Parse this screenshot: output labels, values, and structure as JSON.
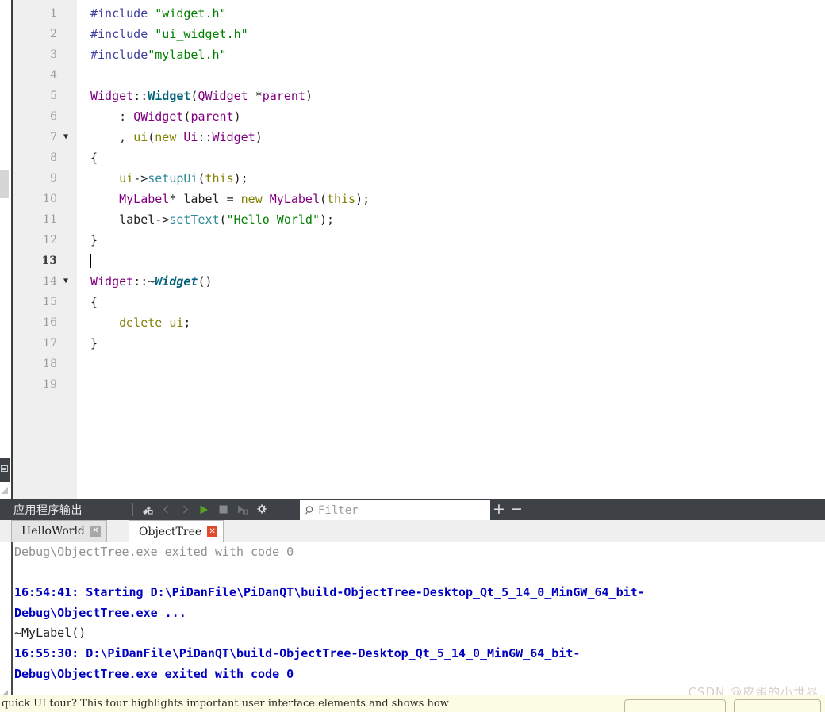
{
  "editor": {
    "lines": [
      {
        "n": "1",
        "fold": "",
        "current": false,
        "tokens": [
          {
            "t": "#include ",
            "c": "t-pre"
          },
          {
            "t": "\"widget.h\"",
            "c": "t-str"
          }
        ]
      },
      {
        "n": "2",
        "fold": "",
        "current": false,
        "tokens": [
          {
            "t": "#include ",
            "c": "t-pre"
          },
          {
            "t": "\"ui_widget.h\"",
            "c": "t-str"
          }
        ]
      },
      {
        "n": "3",
        "fold": "",
        "current": false,
        "tokens": [
          {
            "t": "#include",
            "c": "t-pre"
          },
          {
            "t": "\"mylabel.h\"",
            "c": "t-str"
          }
        ]
      },
      {
        "n": "4",
        "fold": "",
        "current": false,
        "tokens": []
      },
      {
        "n": "5",
        "fold": "",
        "current": false,
        "tokens": [
          {
            "t": "Widget",
            "c": "t-type"
          },
          {
            "t": "::",
            "c": "t-op"
          },
          {
            "t": "Widget",
            "c": "t-funcb"
          },
          {
            "t": "(",
            "c": "t-op"
          },
          {
            "t": "QWidget",
            "c": "t-type"
          },
          {
            "t": " ",
            "c": "t-plain"
          },
          {
            "t": "*",
            "c": "t-op"
          },
          {
            "t": "parent",
            "c": "t-type"
          },
          {
            "t": ")",
            "c": "t-op"
          }
        ]
      },
      {
        "n": "6",
        "fold": "",
        "current": false,
        "tokens": [
          {
            "t": "    : ",
            "c": "t-op"
          },
          {
            "t": "QWidget",
            "c": "t-type"
          },
          {
            "t": "(",
            "c": "t-op"
          },
          {
            "t": "parent",
            "c": "t-type"
          },
          {
            "t": ")",
            "c": "t-op"
          }
        ]
      },
      {
        "n": "7",
        "fold": "▼",
        "current": false,
        "tokens": [
          {
            "t": "    , ",
            "c": "t-op"
          },
          {
            "t": "ui",
            "c": "t-var"
          },
          {
            "t": "(",
            "c": "t-op"
          },
          {
            "t": "new",
            "c": "t-kw"
          },
          {
            "t": " ",
            "c": "t-plain"
          },
          {
            "t": "Ui",
            "c": "t-type"
          },
          {
            "t": "::",
            "c": "t-op"
          },
          {
            "t": "Widget",
            "c": "t-type"
          },
          {
            "t": ")",
            "c": "t-op"
          }
        ]
      },
      {
        "n": "8",
        "fold": "",
        "current": false,
        "tokens": [
          {
            "t": "{",
            "c": "t-op"
          }
        ]
      },
      {
        "n": "9",
        "fold": "",
        "current": false,
        "tokens": [
          {
            "t": "    ",
            "c": "t-plain"
          },
          {
            "t": "ui",
            "c": "t-var"
          },
          {
            "t": "->",
            "c": "t-op"
          },
          {
            "t": "setupUi",
            "c": "t-meth"
          },
          {
            "t": "(",
            "c": "t-op"
          },
          {
            "t": "this",
            "c": "t-kw"
          },
          {
            "t": ");",
            "c": "t-op"
          }
        ]
      },
      {
        "n": "10",
        "fold": "",
        "current": false,
        "tokens": [
          {
            "t": "    ",
            "c": "t-plain"
          },
          {
            "t": "MyLabel",
            "c": "t-type"
          },
          {
            "t": "* ",
            "c": "t-op"
          },
          {
            "t": "label",
            "c": "t-plain"
          },
          {
            "t": " = ",
            "c": "t-op"
          },
          {
            "t": "new",
            "c": "t-kw"
          },
          {
            "t": " ",
            "c": "t-plain"
          },
          {
            "t": "MyLabel",
            "c": "t-type"
          },
          {
            "t": "(",
            "c": "t-op"
          },
          {
            "t": "this",
            "c": "t-kw"
          },
          {
            "t": ");",
            "c": "t-op"
          }
        ]
      },
      {
        "n": "11",
        "fold": "",
        "current": false,
        "tokens": [
          {
            "t": "    ",
            "c": "t-plain"
          },
          {
            "t": "label",
            "c": "t-plain"
          },
          {
            "t": "->",
            "c": "t-op"
          },
          {
            "t": "setText",
            "c": "t-meth"
          },
          {
            "t": "(",
            "c": "t-op"
          },
          {
            "t": "\"Hello World\"",
            "c": "t-str"
          },
          {
            "t": ");",
            "c": "t-op"
          }
        ]
      },
      {
        "n": "12",
        "fold": "",
        "current": false,
        "tokens": [
          {
            "t": "}",
            "c": "t-op"
          }
        ]
      },
      {
        "n": "13",
        "fold": "",
        "current": true,
        "caret": true,
        "tokens": []
      },
      {
        "n": "14",
        "fold": "▼",
        "current": false,
        "tokens": [
          {
            "t": "Widget",
            "c": "t-type"
          },
          {
            "t": "::~",
            "c": "t-op"
          },
          {
            "t": "Widget",
            "c": "t-func"
          },
          {
            "t": "()",
            "c": "t-op"
          }
        ]
      },
      {
        "n": "15",
        "fold": "",
        "current": false,
        "tokens": [
          {
            "t": "{",
            "c": "t-op"
          }
        ]
      },
      {
        "n": "16",
        "fold": "",
        "current": false,
        "tokens": [
          {
            "t": "    ",
            "c": "t-plain"
          },
          {
            "t": "delete",
            "c": "t-kw"
          },
          {
            "t": " ",
            "c": "t-plain"
          },
          {
            "t": "ui",
            "c": "t-var"
          },
          {
            "t": ";",
            "c": "t-op"
          }
        ]
      },
      {
        "n": "17",
        "fold": "",
        "current": false,
        "tokens": [
          {
            "t": "}",
            "c": "t-op"
          }
        ]
      },
      {
        "n": "18",
        "fold": "",
        "current": false,
        "tokens": []
      },
      {
        "n": "19",
        "fold": "",
        "current": false,
        "tokens": []
      }
    ]
  },
  "output": {
    "title": "应用程序输出",
    "toolbar_buttons": [
      {
        "name": "clear-icon",
        "label": "Clear"
      },
      {
        "name": "prev-item-icon",
        "label": "Previous Item"
      },
      {
        "name": "next-item-icon",
        "label": "Next Item"
      },
      {
        "name": "run-icon",
        "label": "Run"
      },
      {
        "name": "stop-icon",
        "label": "Stop"
      },
      {
        "name": "attach-debugger-icon",
        "label": "Attach Debugger to Process"
      },
      {
        "name": "settings-gear-icon",
        "label": "Settings"
      }
    ],
    "filter": {
      "placeholder": "Filter",
      "value": ""
    },
    "zoom_in_label": "+",
    "zoom_out_label": "−",
    "tabs": [
      {
        "label": "HelloWorld",
        "active": false,
        "close": "✕"
      },
      {
        "label": "ObjectTree",
        "active": true,
        "close": "✕"
      }
    ],
    "console_lines": [
      {
        "text": "Debug\\ObjectTree.exe exited with code 0",
        "style": "o-gray"
      },
      {
        "text": "",
        "style": "o-black"
      },
      {
        "text": "16:54:41: Starting D:\\PiDanFile\\PiDanQT\\build-ObjectTree-Desktop_Qt_5_14_0_MinGW_64_bit-",
        "style": "o-blue"
      },
      {
        "text": "Debug\\ObjectTree.exe ...",
        "style": "o-blue"
      },
      {
        "text": "~MyLabel()",
        "style": "o-black"
      },
      {
        "text": "16:55:30: D:\\PiDanFile\\PiDanQT\\build-ObjectTree-Desktop_Qt_5_14_0_MinGW_64_bit-",
        "style": "o-blue"
      },
      {
        "text": "Debug\\ObjectTree.exe exited with code 0",
        "style": "o-blue"
      }
    ]
  },
  "watermark": {
    "text": "CSDN @皮蛋的小世界"
  },
  "status_tooltip": {
    "text": "quick UI tour? This tour highlights important user interface elements and shows how"
  },
  "colors": {
    "toolbar_bg": "#3e4145",
    "gutter_bg": "#efefef",
    "run_green": "#58a700",
    "close_red": "#e04a2f",
    "console_blue": "#0000c0",
    "string_green": "#008000",
    "type_purple": "#800080",
    "keyword_olive": "#808000",
    "method_teal": "#2e8b9b",
    "tooltip_bg": "#fcfbe3"
  }
}
